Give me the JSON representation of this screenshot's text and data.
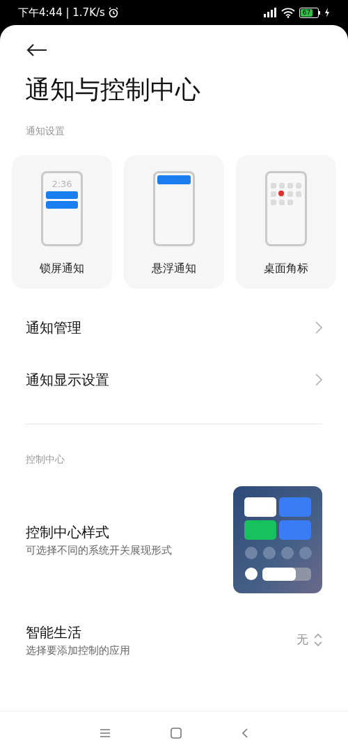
{
  "status_bar": {
    "time": "下午4:44 | 1.7K/s",
    "battery": "67",
    "charging": true
  },
  "title": "通知与控制中心",
  "sections": [
    {
      "header": "通知设置",
      "cards": [
        {
          "kind": "lockscreen",
          "label": "锁屏通知",
          "clock": "2:36"
        },
        {
          "kind": "floating",
          "label": "悬浮通知"
        },
        {
          "kind": "badge",
          "label": "桌面角标"
        }
      ],
      "rows": [
        {
          "kind": "link",
          "title": "通知管理"
        },
        {
          "kind": "link",
          "title": "通知显示设置"
        }
      ]
    },
    {
      "header": "控制中心",
      "rows": [
        {
          "kind": "image",
          "title": "控制中心样式",
          "subtitle": "可选择不同的系统开关展现形式"
        },
        {
          "kind": "select",
          "title": "智能生活",
          "subtitle": "选择要添加控制的应用",
          "value": "无"
        }
      ]
    }
  ]
}
